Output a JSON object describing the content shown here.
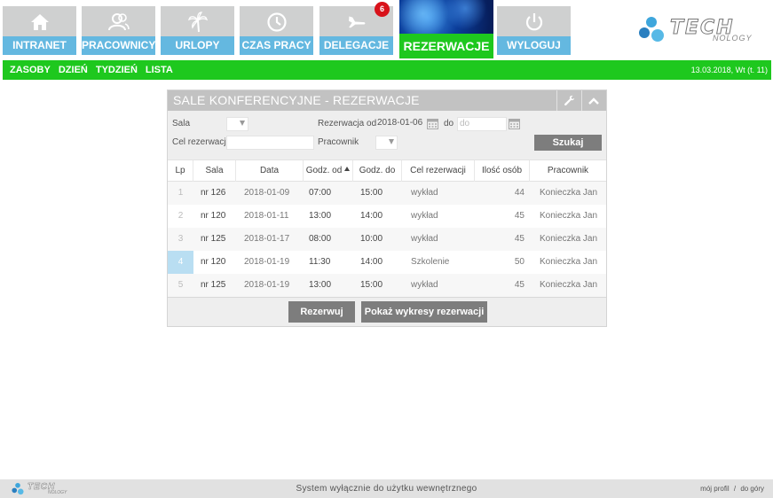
{
  "nav_tiles": [
    {
      "label": "INTRANET",
      "icon": "home-icon",
      "badge": ""
    },
    {
      "label": "PRACOWNICY",
      "icon": "users-icon",
      "badge": ""
    },
    {
      "label": "URLOPY",
      "icon": "palm-tree-icon",
      "badge": ""
    },
    {
      "label": "CZAS PRACY",
      "icon": "clock-icon",
      "badge": ""
    },
    {
      "label": "DELEGACJE",
      "icon": "plane-icon",
      "badge": "6"
    },
    {
      "label": "REZERWACJE",
      "icon": "reservation-tile-image",
      "badge": "",
      "active": true
    },
    {
      "label": "WYLOGUJ",
      "icon": "power-icon",
      "badge": ""
    }
  ],
  "logo": {
    "text": "TECH",
    "subtext": "NOLOGY"
  },
  "subnav": {
    "items": [
      "ZASOBY",
      "DZIEŃ",
      "TYDZIEŃ",
      "LISTA"
    ],
    "date": "13.03.2018, Wt (t. 11)"
  },
  "panel": {
    "title": "SALE KONFERENCYJNE - REZERWACJE",
    "filters": {
      "sala_label": "Sala",
      "rezerwacja_od_label": "Rezerwacja od",
      "rezerwacja_od_value": "2018-01-06",
      "do_label": "do",
      "do_placeholder": "do",
      "cel_label": "Cel rezerwacji",
      "pracownik_label": "Pracownik",
      "search_button": "Szukaj"
    },
    "table": {
      "columns": [
        "Lp",
        "Sala",
        "Data",
        "Godz. od",
        "Godz. do",
        "Cel rezerwacji",
        "Ilość osób",
        "Pracownik"
      ],
      "rows": [
        {
          "lp": "1",
          "sala": "nr 126",
          "data": "2018-01-09",
          "od": "07:00",
          "do": "15:00",
          "cel": "wykład",
          "ilosc": "44",
          "pracownik": "Konieczka Jan"
        },
        {
          "lp": "2",
          "sala": "nr 120",
          "data": "2018-01-11",
          "od": "13:00",
          "do": "14:00",
          "cel": "wykład",
          "ilosc": "45",
          "pracownik": "Konieczka Jan"
        },
        {
          "lp": "3",
          "sala": "nr 125",
          "data": "2018-01-17",
          "od": "08:00",
          "do": "10:00",
          "cel": "wykład",
          "ilosc": "45",
          "pracownik": "Konieczka Jan"
        },
        {
          "lp": "4",
          "sala": "nr 120",
          "data": "2018-01-19",
          "od": "11:30",
          "do": "14:00",
          "cel": "Szkolenie",
          "ilosc": "50",
          "pracownik": "Konieczka Jan"
        },
        {
          "lp": "5",
          "sala": "nr 125",
          "data": "2018-01-19",
          "od": "13:00",
          "do": "15:00",
          "cel": "wykład",
          "ilosc": "45",
          "pracownik": "Konieczka Jan"
        }
      ]
    },
    "buttons": {
      "reserve": "Rezerwuj",
      "charts": "Pokaż wykresy rezerwacji"
    }
  },
  "footer": {
    "text": "System wyłącznie do użytku wewnętrznego",
    "profile_link": "mój profil",
    "separator": "/",
    "top_link": "do góry"
  },
  "colors": {
    "accent_green": "#1ec81e",
    "tile_blue": "#64b8e0",
    "tile_gray": "#cfd0d0",
    "highlight_cell": "#b9def2"
  }
}
